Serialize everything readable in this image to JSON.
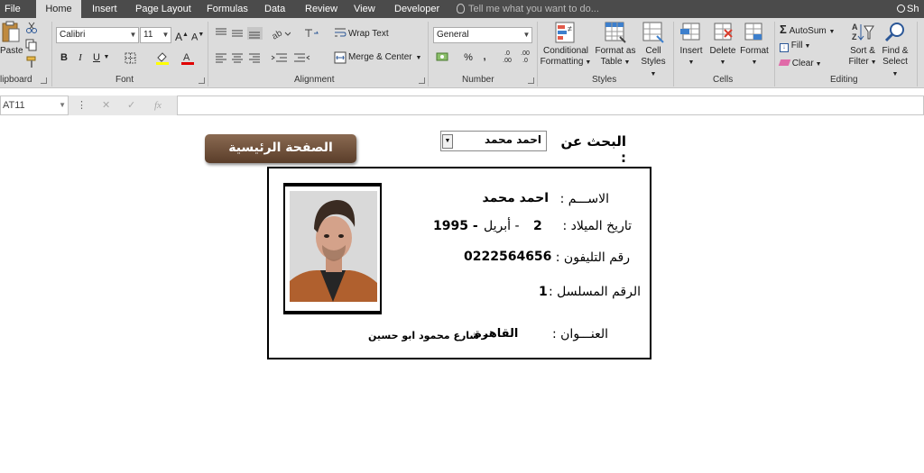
{
  "tabs": [
    "File",
    "Home",
    "Insert",
    "Page Layout",
    "Formulas",
    "Data",
    "Review",
    "View",
    "Developer"
  ],
  "tell_me": "Tell me what you want to do...",
  "share": "Sh",
  "ribbon": {
    "clipboard": {
      "paste": "Paste",
      "label": "lipboard"
    },
    "font": {
      "name": "Calibri",
      "size": "11",
      "label": "Font"
    },
    "alignment": {
      "wrap": "Wrap Text",
      "merge": "Merge & Center",
      "label": "Alignment"
    },
    "number": {
      "format": "General",
      "label": "Number"
    },
    "styles": {
      "cond1": "Conditional",
      "cond2": "Formatting",
      "table1": "Format as",
      "table2": "Table",
      "cell1": "Cell",
      "cell2": "Styles",
      "label": "Styles"
    },
    "cells": {
      "insert": "Insert",
      "delete": "Delete",
      "format": "Format",
      "label": "Cells"
    },
    "editing": {
      "autosum": "AutoSum",
      "fill": "Fill",
      "clear": "Clear",
      "sort1": "Sort &",
      "sort2": "Filter",
      "find1": "Find &",
      "find2": "Select",
      "label": "Editing"
    }
  },
  "formula_bar": {
    "name_box": "AT11",
    "fx": "fx",
    "value": ""
  },
  "sheet": {
    "home_button": "الصفحة الرئيسية",
    "search_label": "البحث عن :",
    "search_value": "احمد محمد",
    "card": {
      "name_label": "الاســـم :",
      "name_value": "احمد محمد",
      "dob_label": "تاريخ الميلاد :",
      "dob_day": "2",
      "dob_month": "-  أبريل",
      "dob_year": "1995  -",
      "phone_label": "رقم التليفون :",
      "phone_value": "0222564656",
      "serial_label": "الرقم المسلسل :",
      "serial_value": "1",
      "address_label": "العنـــوان :",
      "address_city": "القاهرة",
      "address_street": "- شارع محمود ابو حسين"
    }
  }
}
